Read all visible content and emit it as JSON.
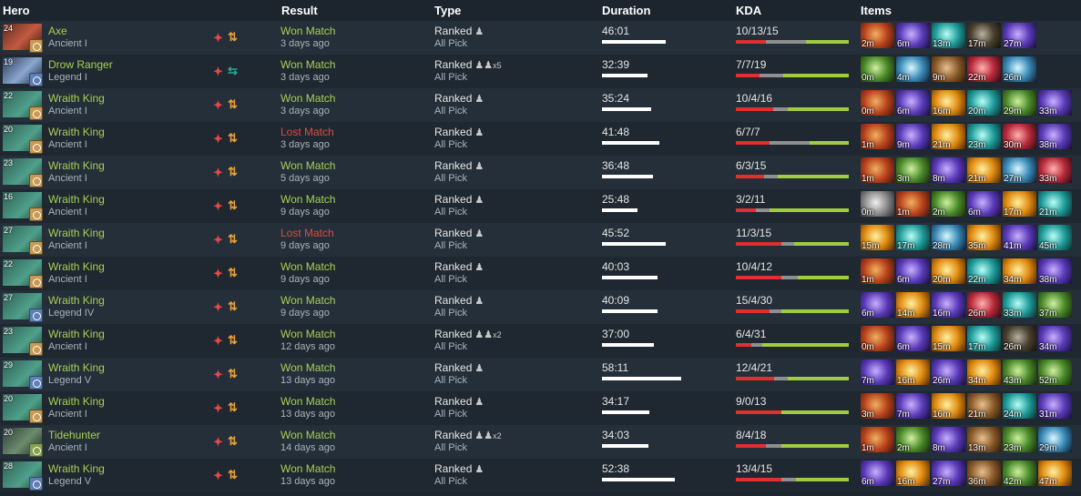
{
  "headers": {
    "hero": "Hero",
    "result": "Result",
    "type": "Type",
    "duration": "Duration",
    "kda": "KDA",
    "items": "Items"
  },
  "rows": [
    {
      "level": "24",
      "hero": "Axe",
      "rank": "Ancient I",
      "portrait": "axe",
      "rankbadge": "ancient",
      "role_alt": false,
      "result": "Won Match",
      "won": true,
      "ago": "3 days ago",
      "type": "Ranked",
      "party": "",
      "mode": "All Pick",
      "duration": "46:01",
      "duration_ratio": 0.8,
      "kda": "10/13/15",
      "kda_ratio": [
        0.27,
        0.35,
        0.38
      ],
      "items": [
        {
          "t": "2m",
          "c": "red"
        },
        {
          "t": "6m",
          "c": "blue"
        },
        {
          "t": "13m",
          "c": "teal"
        },
        {
          "t": "17m",
          "c": "dark"
        },
        {
          "t": "27m",
          "c": "blue"
        }
      ]
    },
    {
      "level": "19",
      "hero": "Drow Ranger",
      "rank": "Legend I",
      "portrait": "drow",
      "rankbadge": "legend",
      "role_alt": true,
      "result": "Won Match",
      "won": true,
      "ago": "3 days ago",
      "type": "Ranked",
      "party": "x5",
      "mode": "All Pick",
      "duration": "32:39",
      "duration_ratio": 0.57,
      "kda": "7/7/19",
      "kda_ratio": [
        0.21,
        0.21,
        0.58
      ],
      "items": [
        {
          "t": "0m",
          "c": "green"
        },
        {
          "t": "4m",
          "c": "aqua"
        },
        {
          "t": "9m",
          "c": "brown"
        },
        {
          "t": "22m",
          "c": "crimson"
        },
        {
          "t": "26m",
          "c": "aqua"
        }
      ]
    },
    {
      "level": "22",
      "hero": "Wraith King",
      "rank": "Ancient I",
      "portrait": "wk",
      "rankbadge": "ancient",
      "role_alt": false,
      "result": "Won Match",
      "won": true,
      "ago": "3 days ago",
      "type": "Ranked",
      "party": "",
      "mode": "All Pick",
      "duration": "35:24",
      "duration_ratio": 0.62,
      "kda": "10/4/16",
      "kda_ratio": [
        0.33,
        0.13,
        0.54
      ],
      "items": [
        {
          "t": "0m",
          "c": "red"
        },
        {
          "t": "6m",
          "c": "blue"
        },
        {
          "t": "16m",
          "c": "gold"
        },
        {
          "t": "20m",
          "c": "teal"
        },
        {
          "t": "29m",
          "c": "green"
        },
        {
          "t": "33m",
          "c": "blue"
        }
      ]
    },
    {
      "level": "20",
      "hero": "Wraith King",
      "rank": "Ancient I",
      "portrait": "wk",
      "rankbadge": "ancient",
      "role_alt": false,
      "result": "Lost Match",
      "won": false,
      "ago": "3 days ago",
      "type": "Ranked",
      "party": "",
      "mode": "All Pick",
      "duration": "41:48",
      "duration_ratio": 0.72,
      "kda": "6/7/7",
      "kda_ratio": [
        0.3,
        0.35,
        0.35
      ],
      "items": [
        {
          "t": "1m",
          "c": "red"
        },
        {
          "t": "9m",
          "c": "blue"
        },
        {
          "t": "21m",
          "c": "gold"
        },
        {
          "t": "23m",
          "c": "teal"
        },
        {
          "t": "30m",
          "c": "crimson"
        },
        {
          "t": "38m",
          "c": "blue"
        }
      ]
    },
    {
      "level": "23",
      "hero": "Wraith King",
      "rank": "Ancient I",
      "portrait": "wk",
      "rankbadge": "ancient",
      "role_alt": false,
      "result": "Won Match",
      "won": true,
      "ago": "5 days ago",
      "type": "Ranked",
      "party": "",
      "mode": "All Pick",
      "duration": "36:48",
      "duration_ratio": 0.64,
      "kda": "6/3/15",
      "kda_ratio": [
        0.25,
        0.12,
        0.63
      ],
      "items": [
        {
          "t": "1m",
          "c": "red"
        },
        {
          "t": "3m",
          "c": "green"
        },
        {
          "t": "8m",
          "c": "blue"
        },
        {
          "t": "21m",
          "c": "gold"
        },
        {
          "t": "27m",
          "c": "aqua"
        },
        {
          "t": "33m",
          "c": "crimson"
        }
      ]
    },
    {
      "level": "16",
      "hero": "Wraith King",
      "rank": "Ancient I",
      "portrait": "wk",
      "rankbadge": "ancient",
      "role_alt": false,
      "result": "Won Match",
      "won": true,
      "ago": "9 days ago",
      "type": "Ranked",
      "party": "",
      "mode": "All Pick",
      "duration": "25:48",
      "duration_ratio": 0.45,
      "kda": "3/2/11",
      "kda_ratio": [
        0.18,
        0.12,
        0.7
      ],
      "items": [
        {
          "t": "0m",
          "c": "grey"
        },
        {
          "t": "1m",
          "c": "red"
        },
        {
          "t": "2m",
          "c": "green"
        },
        {
          "t": "6m",
          "c": "blue"
        },
        {
          "t": "17m",
          "c": "gold"
        },
        {
          "t": "21m",
          "c": "teal"
        }
      ]
    },
    {
      "level": "27",
      "hero": "Wraith King",
      "rank": "Ancient I",
      "portrait": "wk",
      "rankbadge": "ancient",
      "role_alt": false,
      "result": "Lost Match",
      "won": false,
      "ago": "9 days ago",
      "type": "Ranked",
      "party": "",
      "mode": "All Pick",
      "duration": "45:52",
      "duration_ratio": 0.8,
      "kda": "11/3/15",
      "kda_ratio": [
        0.4,
        0.12,
        0.48
      ],
      "items": [
        {
          "t": "15m",
          "c": "gold"
        },
        {
          "t": "17m",
          "c": "teal"
        },
        {
          "t": "28m",
          "c": "aqua"
        },
        {
          "t": "35m",
          "c": "gold"
        },
        {
          "t": "41m",
          "c": "blue"
        },
        {
          "t": "45m",
          "c": "teal"
        }
      ]
    },
    {
      "level": "22",
      "hero": "Wraith King",
      "rank": "Ancient I",
      "portrait": "wk",
      "rankbadge": "ancient",
      "role_alt": false,
      "result": "Won Match",
      "won": true,
      "ago": "9 days ago",
      "type": "Ranked",
      "party": "",
      "mode": "All Pick",
      "duration": "40:03",
      "duration_ratio": 0.7,
      "kda": "10/4/12",
      "kda_ratio": [
        0.4,
        0.15,
        0.45
      ],
      "items": [
        {
          "t": "1m",
          "c": "red"
        },
        {
          "t": "6m",
          "c": "blue"
        },
        {
          "t": "20m",
          "c": "gold"
        },
        {
          "t": "22m",
          "c": "teal"
        },
        {
          "t": "34m",
          "c": "gold"
        },
        {
          "t": "38m",
          "c": "blue"
        }
      ]
    },
    {
      "level": "27",
      "hero": "Wraith King",
      "rank": "Legend IV",
      "portrait": "wk",
      "rankbadge": "legend",
      "role_alt": false,
      "result": "Won Match",
      "won": true,
      "ago": "9 days ago",
      "type": "Ranked",
      "party": "",
      "mode": "All Pick",
      "duration": "40:09",
      "duration_ratio": 0.7,
      "kda": "15/4/30",
      "kda_ratio": [
        0.3,
        0.1,
        0.6
      ],
      "items": [
        {
          "t": "6m",
          "c": "blue"
        },
        {
          "t": "14m",
          "c": "gold"
        },
        {
          "t": "16m",
          "c": "blue"
        },
        {
          "t": "26m",
          "c": "crimson"
        },
        {
          "t": "33m",
          "c": "teal"
        },
        {
          "t": "37m",
          "c": "green"
        }
      ]
    },
    {
      "level": "23",
      "hero": "Wraith King",
      "rank": "Ancient I",
      "portrait": "wk",
      "rankbadge": "ancient",
      "role_alt": false,
      "result": "Won Match",
      "won": true,
      "ago": "12 days ago",
      "type": "Ranked",
      "party": "x2",
      "mode": "All Pick",
      "duration": "37:00",
      "duration_ratio": 0.65,
      "kda": "6/4/31",
      "kda_ratio": [
        0.14,
        0.09,
        0.77
      ],
      "items": [
        {
          "t": "0m",
          "c": "red"
        },
        {
          "t": "6m",
          "c": "blue"
        },
        {
          "t": "15m",
          "c": "gold"
        },
        {
          "t": "17m",
          "c": "teal"
        },
        {
          "t": "26m",
          "c": "dark"
        },
        {
          "t": "34m",
          "c": "blue"
        }
      ]
    },
    {
      "level": "29",
      "hero": "Wraith King",
      "rank": "Legend V",
      "portrait": "wk",
      "rankbadge": "legend",
      "role_alt": false,
      "result": "Won Match",
      "won": true,
      "ago": "13 days ago",
      "type": "Ranked",
      "party": "",
      "mode": "All Pick",
      "duration": "58:11",
      "duration_ratio": 1.0,
      "kda": "12/4/21",
      "kda_ratio": [
        0.34,
        0.12,
        0.54
      ],
      "items": [
        {
          "t": "7m",
          "c": "blue"
        },
        {
          "t": "16m",
          "c": "gold"
        },
        {
          "t": "26m",
          "c": "blue"
        },
        {
          "t": "34m",
          "c": "gold"
        },
        {
          "t": "43m",
          "c": "green"
        },
        {
          "t": "52m",
          "c": "green"
        }
      ]
    },
    {
      "level": "20",
      "hero": "Wraith King",
      "rank": "Ancient I",
      "portrait": "wk",
      "rankbadge": "ancient",
      "role_alt": false,
      "result": "Won Match",
      "won": true,
      "ago": "13 days ago",
      "type": "Ranked",
      "party": "",
      "mode": "All Pick",
      "duration": "34:17",
      "duration_ratio": 0.6,
      "kda": "9/0/13",
      "kda_ratio": [
        0.4,
        0.0,
        0.6
      ],
      "items": [
        {
          "t": "3m",
          "c": "red"
        },
        {
          "t": "7m",
          "c": "blue"
        },
        {
          "t": "16m",
          "c": "gold"
        },
        {
          "t": "21m",
          "c": "brown"
        },
        {
          "t": "24m",
          "c": "teal"
        },
        {
          "t": "31m",
          "c": "blue"
        }
      ]
    },
    {
      "level": "20",
      "hero": "Tidehunter",
      "rank": "Ancient I",
      "portrait": "tide",
      "rankbadge": "tide",
      "role_alt": false,
      "result": "Won Match",
      "won": true,
      "ago": "14 days ago",
      "type": "Ranked",
      "party": "x2",
      "mode": "All Pick",
      "duration": "34:03",
      "duration_ratio": 0.59,
      "kda": "8/4/18",
      "kda_ratio": [
        0.27,
        0.13,
        0.6
      ],
      "items": [
        {
          "t": "1m",
          "c": "red"
        },
        {
          "t": "2m",
          "c": "green"
        },
        {
          "t": "8m",
          "c": "blue"
        },
        {
          "t": "13m",
          "c": "brown"
        },
        {
          "t": "23m",
          "c": "green"
        },
        {
          "t": "29m",
          "c": "aqua"
        }
      ]
    },
    {
      "level": "28",
      "hero": "Wraith King",
      "rank": "Legend V",
      "portrait": "wk",
      "rankbadge": "legend",
      "role_alt": false,
      "result": "Won Match",
      "won": true,
      "ago": "13 days ago",
      "type": "Ranked",
      "party": "",
      "mode": "All Pick",
      "duration": "52:38",
      "duration_ratio": 0.92,
      "kda": "13/4/15",
      "kda_ratio": [
        0.4,
        0.13,
        0.47
      ],
      "items": [
        {
          "t": "6m",
          "c": "blue"
        },
        {
          "t": "16m",
          "c": "gold"
        },
        {
          "t": "27m",
          "c": "blue"
        },
        {
          "t": "36m",
          "c": "brown"
        },
        {
          "t": "42m",
          "c": "green"
        },
        {
          "t": "47m",
          "c": "gold"
        }
      ]
    }
  ]
}
